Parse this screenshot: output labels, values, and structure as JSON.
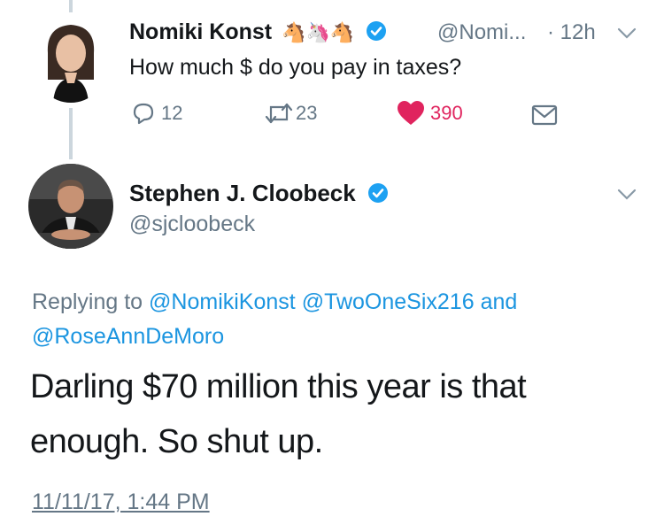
{
  "tweet1": {
    "display_name": "Nomiki Konst",
    "emojis": "🐴🦄🐴",
    "handle": "@Nomi...",
    "time": "· 12h",
    "text": "How much $ do you pay in taxes?",
    "reply_count": "12",
    "retweet_count": "23",
    "like_count": "390",
    "colors": {
      "like": "#e0245e",
      "verified": "#1da1f2"
    },
    "icons": [
      "reply-icon",
      "retweet-icon",
      "heart-icon",
      "message-icon",
      "chevron-down-icon"
    ]
  },
  "tweet2": {
    "display_name": "Stephen J. Cloobeck",
    "handle": "@sjcloobeck",
    "replying_prefix": "Replying to",
    "reply_to_1": "@NomikiKonst",
    "reply_to_2": "@TwoOneSix216",
    "reply_to_and": "and",
    "reply_to_3": "@RoseAnnDeMoro",
    "text_line1": "Darling $70 million this year is that",
    "text_line2": "enough. So shut up.",
    "timestamp": "11/11/17, 1:44 PM",
    "colors": {
      "link": "#1b95e0",
      "muted": "#657786"
    }
  }
}
